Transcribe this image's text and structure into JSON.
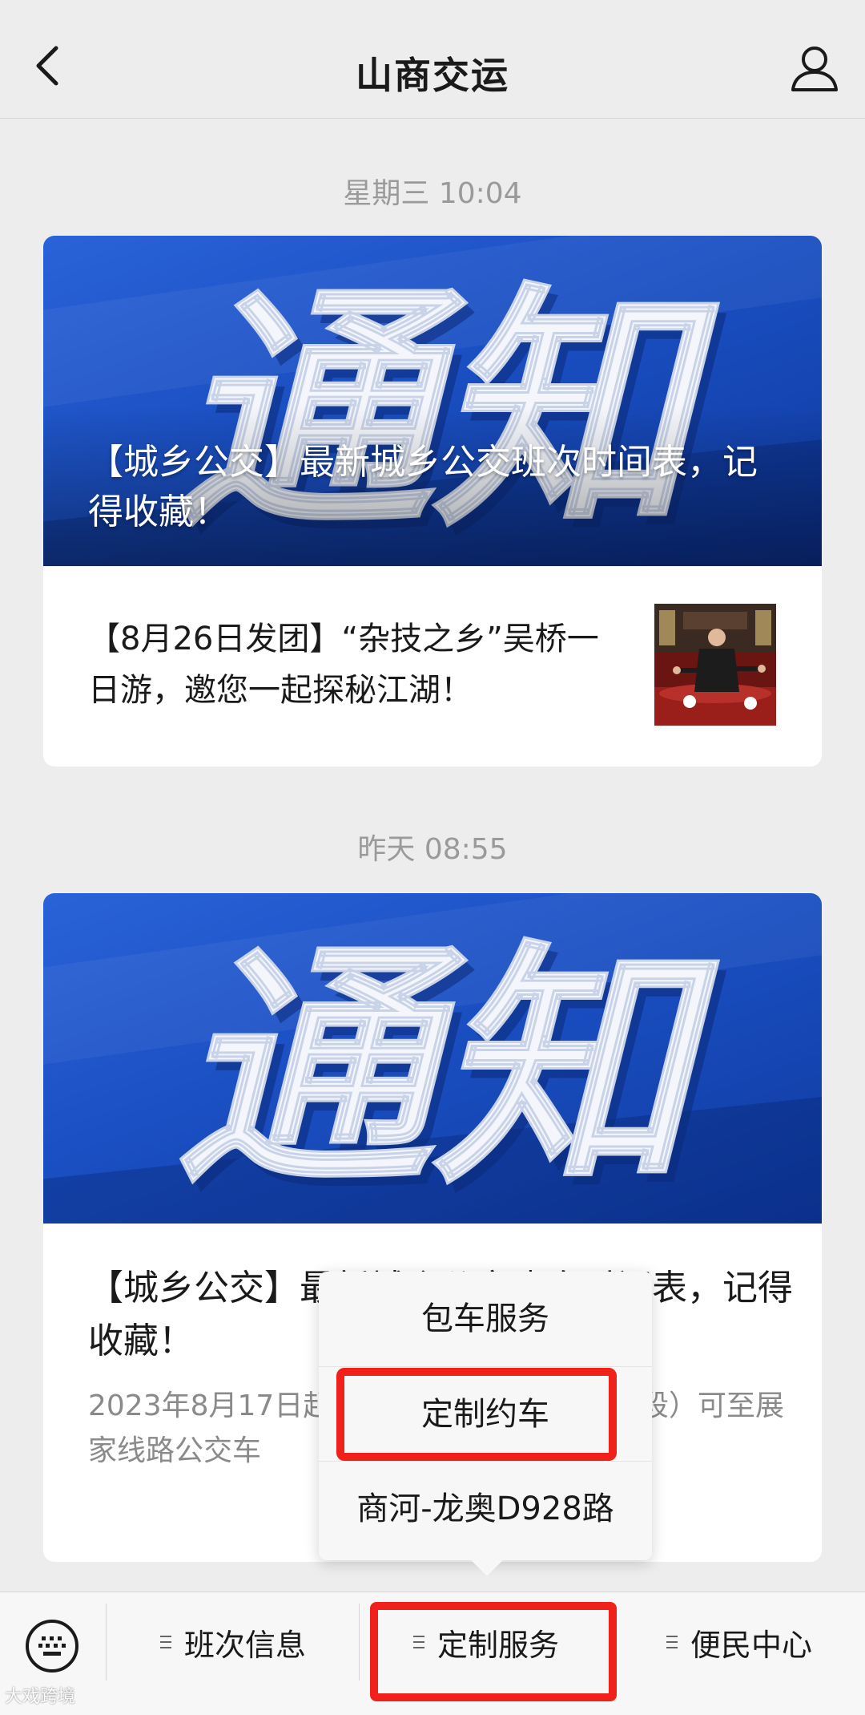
{
  "header": {
    "title": "山商交运"
  },
  "feed": [
    {
      "timestamp": "星期三 10:04",
      "cover_art_text": "通知",
      "cover_title": "【城乡公交】最新城乡公交班次时间表，记得收藏！",
      "secondary_article": "【8月26日发团】“杂技之乡”吴桥一日游，邀您一起探秘江湖！"
    },
    {
      "timestamp": "昨天 08:55",
      "cover_art_text": "通知",
      "title": "【城乡公交】最新城乡公交班次时间表，记得收藏！",
      "digest": "2023年8月17日起，商展路（孙集—G340段）可至展家线路公交车"
    }
  ],
  "popup_menu": {
    "items": [
      "包车服务",
      "定制约车",
      "商河-龙奥D928路"
    ],
    "highlighted_item": "定制约车"
  },
  "bottom_menu": {
    "items": [
      "班次信息",
      "定制服务",
      "便民中心"
    ],
    "highlighted_item": "定制服务"
  },
  "watermark": "大戏跨境",
  "colors": {
    "highlight": "#f0201a",
    "cover_blue": "#1a4fc2",
    "background": "#ededed"
  },
  "icons": {
    "back": "chevron-left-icon",
    "profile": "person-icon",
    "keyboard": "keyboard-icon",
    "menu": "menu-lines-icon"
  }
}
